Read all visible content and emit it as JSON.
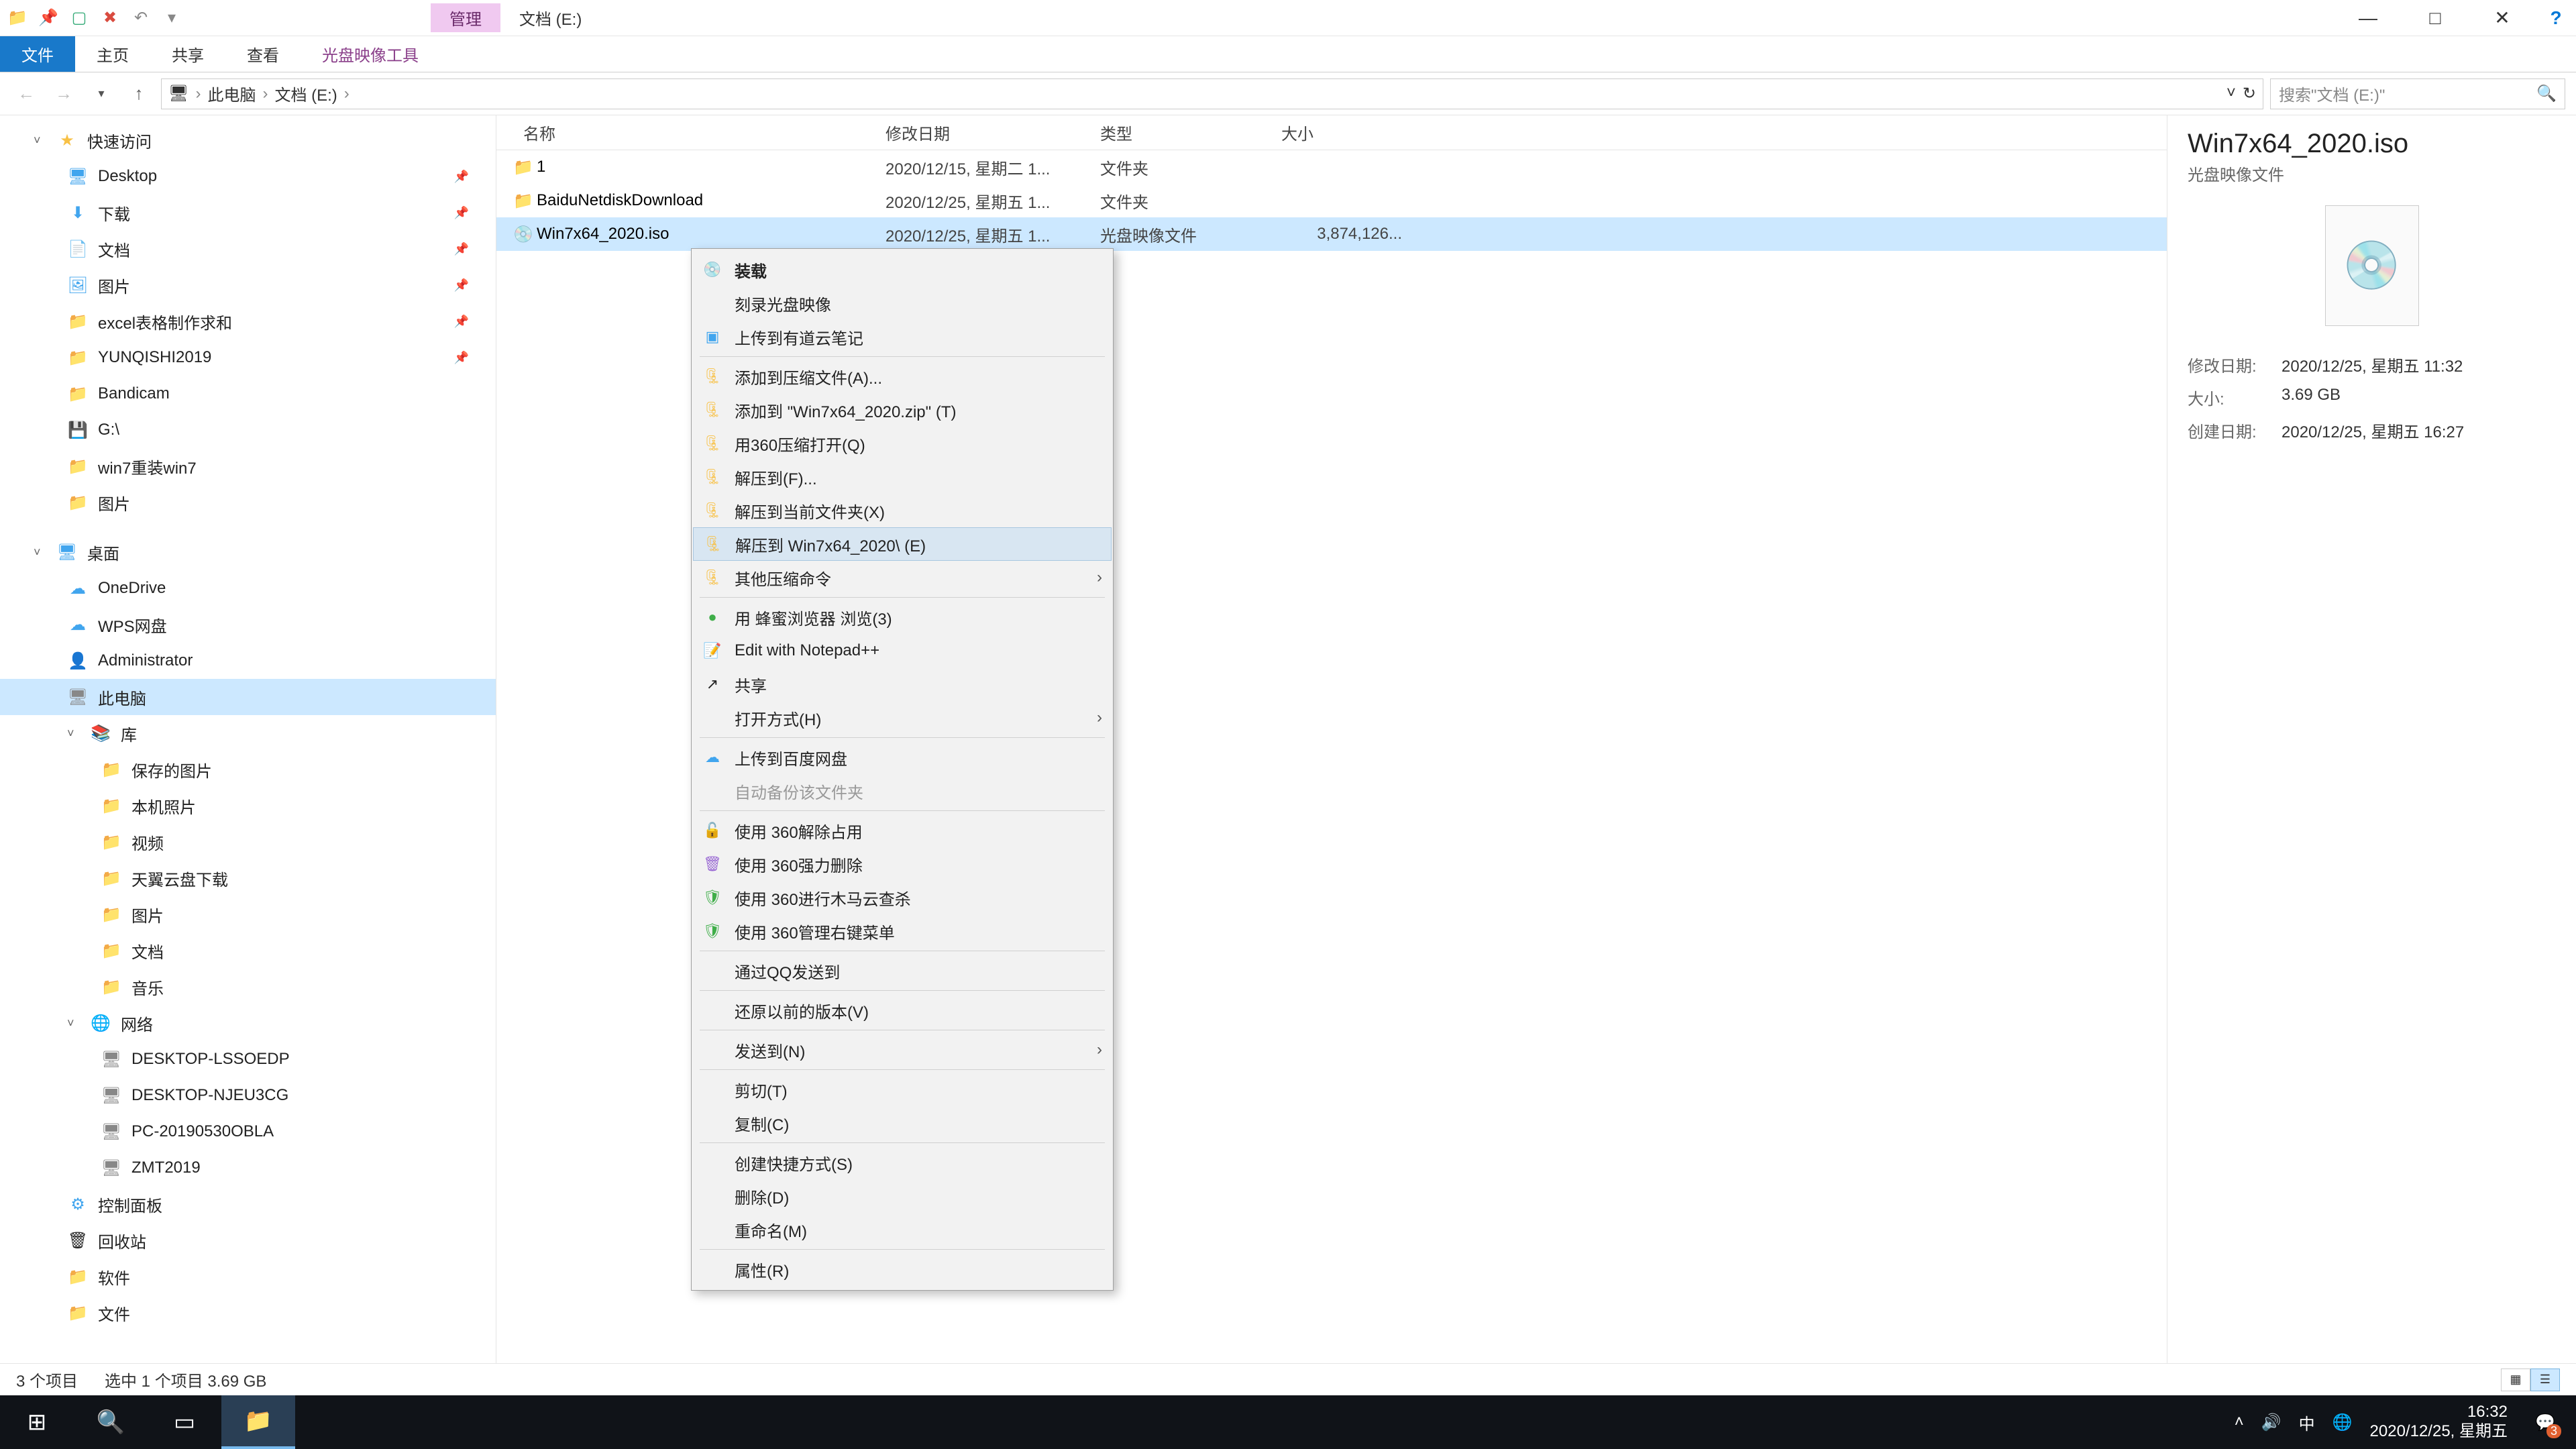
{
  "title_tabs": {
    "manage": "管理",
    "location": "文档 (E:)"
  },
  "window_controls": {
    "min": "—",
    "max": "□",
    "close": "✕",
    "help": "?"
  },
  "ribbon": {
    "file": "文件",
    "home": "主页",
    "share": "共享",
    "view": "查看",
    "disc_tool": "光盘映像工具"
  },
  "addr": {
    "back": "←",
    "fwd": "→",
    "down": "▾",
    "up": "↑",
    "pc_icon": "🖥",
    "this_pc": "此电脑",
    "drive": "文档 (E:)",
    "refresh": "↻",
    "drop": "˅",
    "search_ph": "搜索\"文档 (E:)\"",
    "search_icon": "🔍"
  },
  "tree": {
    "quick": "快速访问",
    "desktop": "Desktop",
    "downloads": "下载",
    "documents": "文档",
    "pictures": "图片",
    "excel": "excel表格制作求和",
    "yunqishi": "YUNQISHI2019",
    "bandicam": "Bandicam",
    "gdrive": "G:\\",
    "win7": "win7重装win7",
    "pics2": "图片",
    "desk_root": "桌面",
    "onedrive": "OneDrive",
    "wps": "WPS网盘",
    "admin": "Administrator",
    "thispc": "此电脑",
    "library": "库",
    "savedpics": "保存的图片",
    "localpics": "本机照片",
    "video": "视频",
    "tianyi": "天翼云盘下载",
    "pics3": "图片",
    "docs2": "文档",
    "music": "音乐",
    "network": "网络",
    "pc1": "DESKTOP-LSSOEDP",
    "pc2": "DESKTOP-NJEU3CG",
    "pc3": "PC-20190530OBLA",
    "pc4": "ZMT2019",
    "ctrl": "控制面板",
    "recycle": "回收站",
    "soft": "软件",
    "files": "文件"
  },
  "headers": {
    "name": "名称",
    "date": "修改日期",
    "type": "类型",
    "size": "大小"
  },
  "rows": [
    {
      "ico": "📁",
      "name": "1",
      "date": "2020/12/15, 星期二 1...",
      "type": "文件夹",
      "size": ""
    },
    {
      "ico": "📁",
      "name": "BaiduNetdiskDownload",
      "date": "2020/12/25, 星期五 1...",
      "type": "文件夹",
      "size": ""
    },
    {
      "ico": "💿",
      "name": "Win7x64_2020.iso",
      "date": "2020/12/25, 星期五 1...",
      "type": "光盘映像文件",
      "size": "3,874,126..."
    }
  ],
  "ctx": {
    "mount": "装载",
    "burn": "刻录光盘映像",
    "youd": "上传到有道云笔记",
    "addzip": "添加到压缩文件(A)...",
    "addzip2": "添加到 \"Win7x64_2020.zip\" (T)",
    "open360": "用360压缩打开(Q)",
    "extf": "解压到(F)...",
    "extcur": "解压到当前文件夹(X)",
    "extname": "解压到 Win7x64_2020\\ (E)",
    "otherzip": "其他压缩命令",
    "bee": "用 蜂蜜浏览器 浏览(3)",
    "npp": "Edit with Notepad++",
    "share": "共享",
    "openwith": "打开方式(H)",
    "baidu": "上传到百度网盘",
    "autobak": "自动备份该文件夹",
    "u360a": "使用 360解除占用",
    "u360b": "使用 360强力删除",
    "u360c": "使用 360进行木马云查杀",
    "u360d": "使用 360管理右键菜单",
    "qq": "通过QQ发送到",
    "restore": "还原以前的版本(V)",
    "sendto": "发送到(N)",
    "cut": "剪切(T)",
    "copy": "复制(C)",
    "shortcut": "创建快捷方式(S)",
    "delete": "删除(D)",
    "rename": "重命名(M)",
    "props": "属性(R)"
  },
  "details": {
    "title": "Win7x64_2020.iso",
    "subtitle": "光盘映像文件",
    "mdate_k": "修改日期:",
    "mdate_v": "2020/12/25, 星期五 11:32",
    "size_k": "大小:",
    "size_v": "3.69 GB",
    "cdate_k": "创建日期:",
    "cdate_v": "2020/12/25, 星期五 16:27"
  },
  "status": {
    "count": "3 个项目",
    "sel": "选中 1 个项目  3.69 GB"
  },
  "taskbar": {
    "start": "⊞",
    "search": "🔍",
    "taskview": "▭",
    "explorer": "📁",
    "up": "˄",
    "vol": "🔊",
    "ime": "中",
    "net": "🌐",
    "time": "16:32",
    "date": "2020/12/25, 星期五",
    "notif": "💬",
    "badge": "3"
  }
}
